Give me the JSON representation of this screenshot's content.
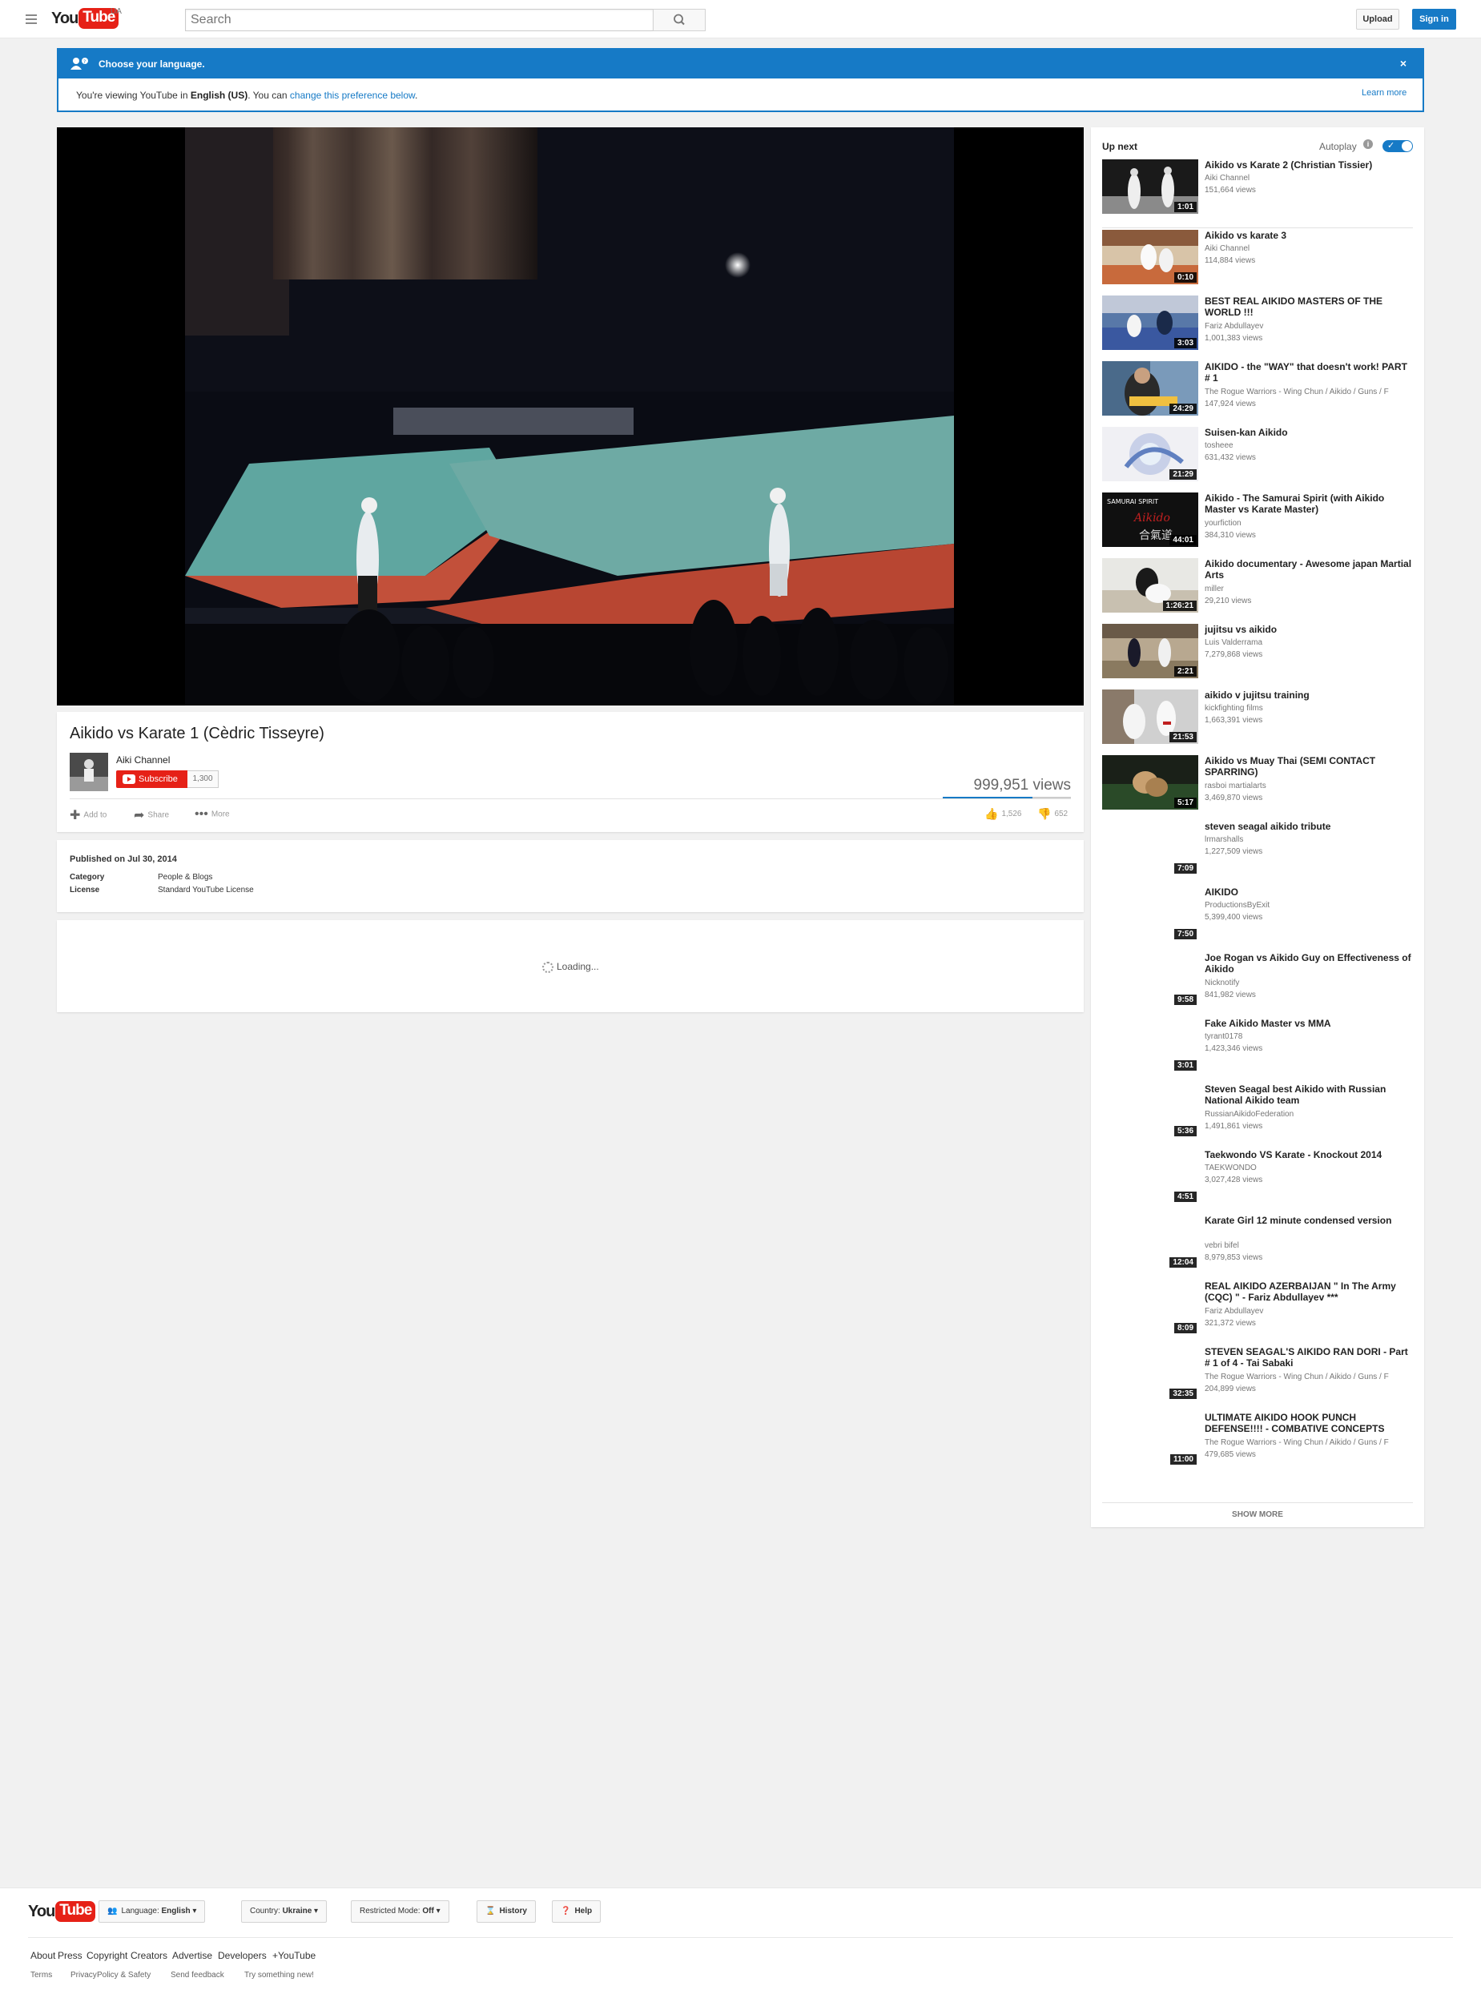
{
  "masthead": {
    "logo_you": "You",
    "logo_tube": "Tube",
    "country_code": "UA",
    "search_placeholder": "Search",
    "upload_label": "Upload",
    "signin_label": "Sign in"
  },
  "language_banner": {
    "title": "Choose your language.",
    "text_before": "You're viewing YouTube in ",
    "language": "English (US)",
    "text_mid": ". You can ",
    "link": "change this preference below",
    "text_after": ".",
    "learn_more": "Learn more"
  },
  "video": {
    "title": "Aikido vs Karate 1 (Cèdric Tisseyre)",
    "channel": "Aiki Channel",
    "subscribe_label": "Subscribe",
    "subscriber_count": "1,300",
    "views": "999,951 views",
    "like_ratio": 0.7,
    "add_to_label": "Add to",
    "share_label": "Share",
    "more_label": "More",
    "likes": "1,526",
    "dislikes": "652"
  },
  "details": {
    "published": "Published on Jul 30, 2014",
    "category_label": "Category",
    "category_value": "People & Blogs",
    "license_label": "License",
    "license_value": "Standard YouTube License"
  },
  "comments": {
    "loading": "Loading..."
  },
  "sidebar": {
    "up_next": "Up next",
    "autoplay": "Autoplay",
    "show_more": "SHOW MORE",
    "items": [
      {
        "title": "Aikido vs Karate 2 (Christian Tissier)",
        "channel": "Aiki Channel",
        "views": "151,664 views",
        "duration": "1:01",
        "thumb": "t1"
      },
      {
        "title": "Aikido vs karate 3",
        "channel": "Aiki Channel",
        "views": "114,884 views",
        "duration": "0:10",
        "thumb": "t2"
      },
      {
        "title": "BEST REAL AIKIDO MASTERS OF THE WORLD !!!",
        "channel": "Fariz Abdullayev",
        "views": "1,001,383 views",
        "duration": "3:03",
        "thumb": "t3"
      },
      {
        "title": "AIKIDO - the \"WAY\" that doesn't work! PART # 1",
        "channel": "The Rogue Warriors - Wing Chun / Aikido / Guns / F",
        "views": "147,924 views",
        "duration": "24:29",
        "thumb": "t4"
      },
      {
        "title": "Suisen-kan Aikido",
        "channel": "tosheee",
        "views": "631,432 views",
        "duration": "21:29",
        "thumb": "t5"
      },
      {
        "title": "Aikido - The Samurai Spirit (with Aikido Master vs Karate Master)",
        "channel": "yourfiction",
        "views": "384,310 views",
        "duration": "44:01",
        "thumb": "t6"
      },
      {
        "title": "Aikido documentary - Awesome japan Martial Arts",
        "channel": "miller",
        "views": "29,210 views",
        "duration": "1:26:21",
        "thumb": "t7"
      },
      {
        "title": "jujitsu vs aikido",
        "channel": "Luis Valderrama",
        "views": "7,279,868 views",
        "duration": "2:21",
        "thumb": "t8"
      },
      {
        "title": "aikido v jujitsu training",
        "channel": "kickfighting films",
        "views": "1,663,391 views",
        "duration": "21:53",
        "thumb": "t9"
      },
      {
        "title": "Aikido vs Muay Thai (SEMI CONTACT SPARRING)",
        "channel": "rasboi martialarts",
        "views": "3,469,870 views",
        "duration": "5:17",
        "thumb": "t10"
      },
      {
        "title": "steven seagal aikido tribute",
        "channel": "lrmarshalls",
        "views": "1,227,509 views",
        "duration": "7:09",
        "thumb": "blank"
      },
      {
        "title": "AIKIDO",
        "channel": "ProductionsByExit",
        "views": "5,399,400 views",
        "duration": "7:50",
        "thumb": "blank"
      },
      {
        "title": "Joe Rogan vs Aikido Guy on Effectiveness of Aikido",
        "channel": "Nicknotify",
        "views": "841,982 views",
        "duration": "9:58",
        "thumb": "blank"
      },
      {
        "title": "Fake Aikido Master vs MMA",
        "channel": "tyrant0178",
        "views": "1,423,346 views",
        "duration": "3:01",
        "thumb": "blank"
      },
      {
        "title": "Steven Seagal best Aikido with Russian National Aikido team",
        "channel": "RussianAikidoFederation",
        "views": "1,491,861 views",
        "duration": "5:36",
        "thumb": "blank"
      },
      {
        "title": "Taekwondo VS Karate - Knockout 2014",
        "channel": "TAEKWONDO",
        "views": "3,027,428 views",
        "duration": "4:51",
        "thumb": "blank"
      },
      {
        "title": "Karate Girl 12 minute condensed version",
        "channel": "vebri bifel",
        "views": "8,979,853 views",
        "duration": "12:04",
        "thumb": "blank"
      },
      {
        "title": "REAL AIKIDO AZERBAIJAN \" In The Army (CQC) \" - Fariz Abdullayev ***",
        "channel": "Fariz Abdullayev",
        "views": "321,372 views",
        "duration": "8:09",
        "thumb": "blank"
      },
      {
        "title": "STEVEN SEAGAL'S AIKIDO RAN DORI - Part # 1 of 4 - Tai Sabaki",
        "channel": "The Rogue Warriors - Wing Chun / Aikido / Guns / F",
        "views": "204,899 views",
        "duration": "32:35",
        "thumb": "blank"
      },
      {
        "title": "ULTIMATE AIKIDO HOOK PUNCH DEFENSE!!!! - COMBATIVE CONCEPTS",
        "channel": "The Rogue Warriors - Wing Chun / Aikido / Guns / F",
        "views": "479,685 views",
        "duration": "11:00",
        "thumb": "blank"
      }
    ]
  },
  "footer": {
    "language_label": "Language:",
    "language_value": "English",
    "country_label": "Country:",
    "country_value": "Ukraine",
    "restricted_label": "Restricted Mode:",
    "restricted_value": "Off",
    "history_label": "History",
    "help_label": "Help",
    "links_primary": [
      "About",
      "Press",
      "Copyright",
      "Creators",
      "Advertise",
      "Developers",
      "+YouTube"
    ],
    "links_secondary": [
      "Terms",
      "Privacy",
      "Policy & Safety",
      "Send feedback",
      "Try something new!"
    ]
  },
  "colors": {
    "accent_blue": "#167ac6",
    "brand_red": "#e62117",
    "background": "#f1f1f1"
  }
}
